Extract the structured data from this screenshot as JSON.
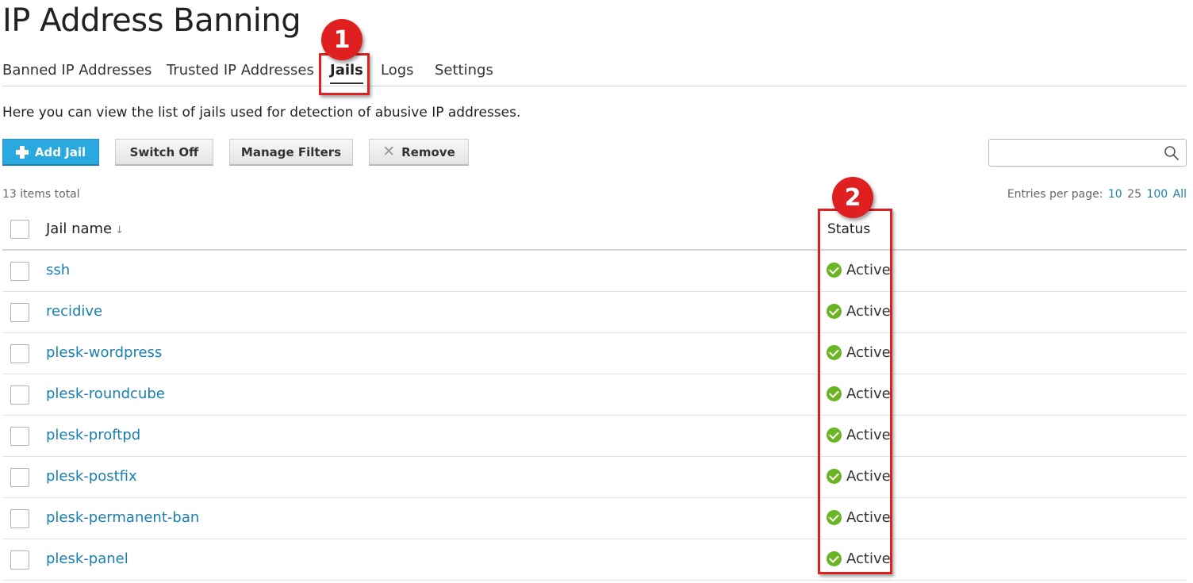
{
  "page": {
    "title": "IP Address Banning",
    "intro": "Here you can view the list of jails used for detection of abusive IP addresses."
  },
  "tabs": [
    {
      "label": "Banned IP Addresses",
      "active": false
    },
    {
      "label": "Trusted IP Addresses",
      "active": false
    },
    {
      "label": "Jails",
      "active": true
    },
    {
      "label": "Logs",
      "active": false
    },
    {
      "label": "Settings",
      "active": false
    }
  ],
  "toolbar": {
    "add_label": "Add Jail",
    "switch_off_label": "Switch Off",
    "manage_filters_label": "Manage Filters",
    "remove_label": "Remove",
    "search_placeholder": ""
  },
  "list": {
    "items_total": "13 items total",
    "entries_label": "Entries per page:",
    "entries_options": [
      "10",
      "25",
      "100",
      "All"
    ],
    "columns": {
      "name": "Jail name",
      "status": "Status"
    },
    "rows": [
      {
        "name": "ssh",
        "status": "Active"
      },
      {
        "name": "recidive",
        "status": "Active"
      },
      {
        "name": "plesk-wordpress",
        "status": "Active"
      },
      {
        "name": "plesk-roundcube",
        "status": "Active"
      },
      {
        "name": "plesk-proftpd",
        "status": "Active"
      },
      {
        "name": "plesk-postfix",
        "status": "Active"
      },
      {
        "name": "plesk-permanent-ban",
        "status": "Active"
      },
      {
        "name": "plesk-panel",
        "status": "Active"
      }
    ]
  },
  "annotations": [
    {
      "number": "1"
    },
    {
      "number": "2"
    }
  ],
  "colors": {
    "primary": "#29a9e0",
    "link": "#1a7fae",
    "active_status": "#6bb524",
    "annotation": "#e02020"
  }
}
